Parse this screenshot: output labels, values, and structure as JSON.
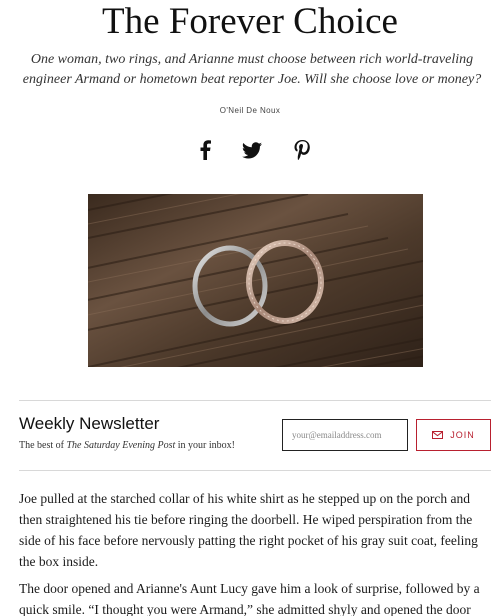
{
  "article": {
    "title": "The Forever Choice",
    "dek": "One woman, two rings, and Arianne must choose between rich world-traveling engineer Armand or hometown beat reporter Joe. Will she choose love or money?",
    "author": "O'Neil De Noux"
  },
  "share": {
    "icons": [
      "facebook-icon",
      "twitter-icon",
      "pinterest-icon"
    ]
  },
  "newsletter": {
    "title": "Weekly Newsletter",
    "subtitle_prefix": "The best of ",
    "subtitle_publication": "The Saturday Evening Post",
    "subtitle_suffix": " in your inbox!",
    "email_placeholder": "your@emailaddress.com",
    "email_value": "",
    "join_label": "JOIN",
    "accent_color": "#b8202f"
  },
  "body": {
    "paragraphs": [
      "Joe pulled at the starched collar of his white shirt as he stepped up on the porch and then straightened his tie before ringing the doorbell. He wiped perspiration from the side of his face before nervously patting the right pocket of his gray suit coat, feeling the box inside.",
      "The door opened and Arianne's Aunt Lucy gave him a look of surprise, followed by a quick smile. “I thought you were Armand,” she admitted shyly and opened the door"
    ]
  }
}
